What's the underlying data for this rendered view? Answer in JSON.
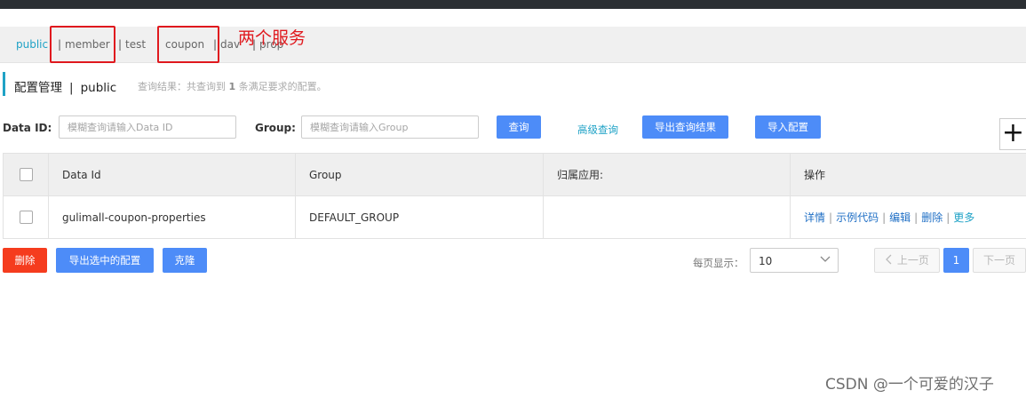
{
  "namespaces": [
    {
      "label": "public"
    },
    {
      "label": "member"
    },
    {
      "label": "test"
    },
    {
      "label": "coupon"
    },
    {
      "label": "dav"
    },
    {
      "label": "prop"
    }
  ],
  "annotation": "两个服务",
  "header": {
    "title": "配置管理",
    "separator": "|",
    "namespace": "public",
    "query_info_prefix": "查询结果：共查询到",
    "query_count": "1",
    "query_info_suffix": "条满足要求的配置。"
  },
  "search": {
    "data_id_label": "Data ID:",
    "data_id_placeholder": "模糊查询请输入Data ID",
    "group_label": "Group:",
    "group_placeholder": "模糊查询请输入Group",
    "query_button": "查询",
    "advanced_link": "高级查询",
    "export_results_button": "导出查询结果",
    "import_button": "导入配置",
    "plus_symbol": "+"
  },
  "table": {
    "columns": [
      "Data Id",
      "Group",
      "归属应用:",
      "操作"
    ],
    "rows": [
      {
        "data_id": "gulimall-coupon-properties",
        "group": "DEFAULT_GROUP",
        "app": "",
        "actions": [
          "详情",
          "示例代码",
          "编辑",
          "删除",
          "更多"
        ]
      }
    ]
  },
  "bulk": {
    "delete_button": "删除",
    "export_selected_button": "导出选中的配置",
    "clone_button": "克隆"
  },
  "pagination": {
    "per_page_label": "每页显示：",
    "per_page_value": "10",
    "prev_label": "上一页",
    "current_page": "1",
    "next_label": "下一页"
  },
  "watermark": "CSDN @一个可爱的汉子",
  "colors": {
    "accent": "#1fa2c6",
    "primary_button": "#4d8cf8",
    "danger_button": "#f53c1e",
    "annotation_red": "#e0191e"
  }
}
